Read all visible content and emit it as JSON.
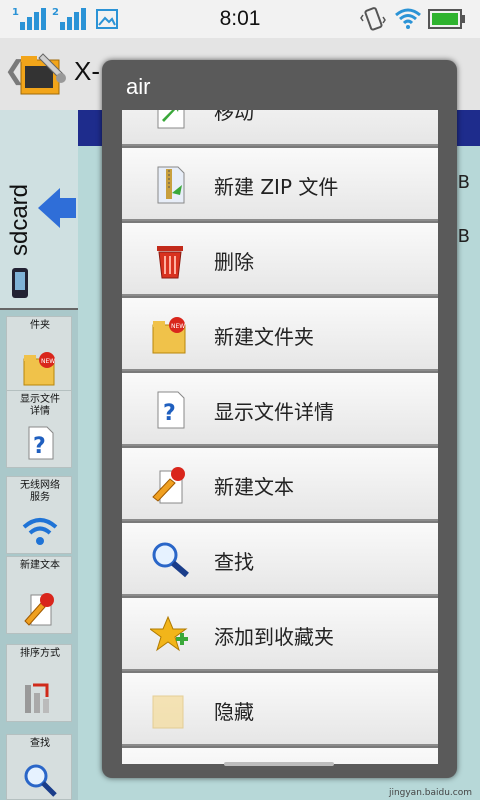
{
  "status": {
    "time": "8:01",
    "signal1": "1",
    "signal2": "2"
  },
  "header": {
    "title": "X-"
  },
  "side": {
    "storage_label": "sdcard",
    "tools": [
      {
        "label": "件夹"
      },
      {
        "label": "显示文件详情"
      },
      {
        "label": "无线网络服务"
      },
      {
        "label": "新建文本"
      },
      {
        "label": "排序方式"
      },
      {
        "label": "查找"
      }
    ]
  },
  "background": {
    "size_suffix_1": "B",
    "size_suffix_2": "B"
  },
  "menu": {
    "title": "air",
    "items": [
      {
        "label": "移动",
        "icon": "move-icon"
      },
      {
        "label": "新建 ZIP 文件",
        "icon": "zip-icon"
      },
      {
        "label": "删除",
        "icon": "trash-icon"
      },
      {
        "label": "新建文件夹",
        "icon": "new-folder-icon"
      },
      {
        "label": "显示文件详情",
        "icon": "file-info-icon"
      },
      {
        "label": "新建文本",
        "icon": "new-text-icon"
      },
      {
        "label": "查找",
        "icon": "search-icon"
      },
      {
        "label": "添加到收藏夹",
        "icon": "favorite-icon"
      },
      {
        "label": "隐藏",
        "icon": "hide-icon"
      }
    ]
  },
  "watermark": "jingyan.baidu.com",
  "colors": {
    "accent": "#2b93d6",
    "header_bg": "#e4e4e4",
    "menu_frame": "#5a5a5a"
  }
}
